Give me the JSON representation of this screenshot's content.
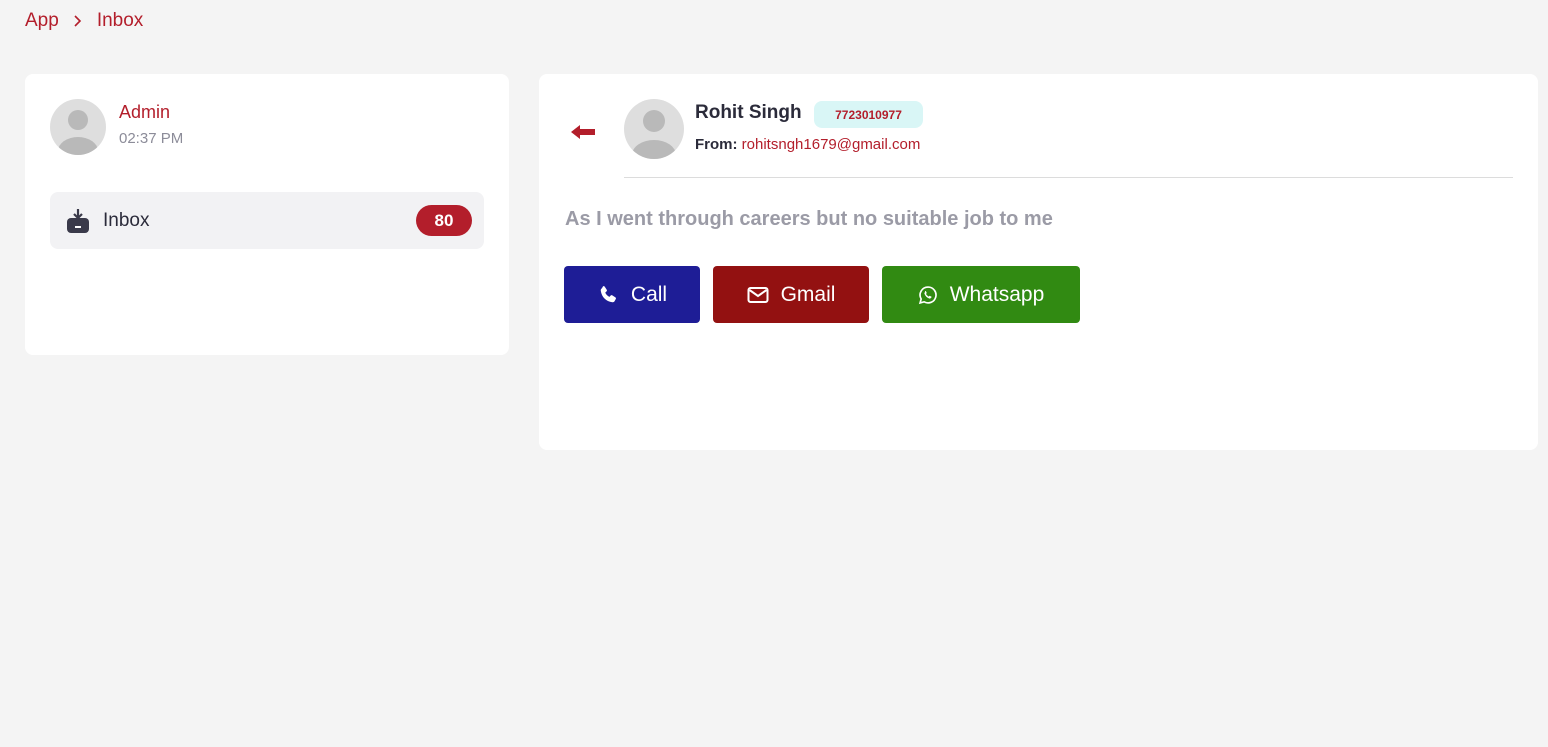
{
  "breadcrumb": {
    "items": [
      "App",
      "Inbox"
    ]
  },
  "sidebar": {
    "user": {
      "name": "Admin",
      "time": "02:37 PM"
    },
    "inbox": {
      "label": "Inbox",
      "count": "80"
    }
  },
  "message_view": {
    "sender_name": "Rohit Singh",
    "phone": "7723010977",
    "from_label": "From:",
    "from_email": "rohitsngh1679@gmail.com",
    "body": "As I went through careers but no suitable job to me",
    "actions": {
      "call": "Call",
      "gmail": "Gmail",
      "whatsapp": "Whatsapp"
    }
  },
  "colors": {
    "accent": "#b31e2b",
    "call": "#1e1d96",
    "gmail": "#931111",
    "whatsapp": "#318a12",
    "phone_badge_bg": "#d9f6f6"
  },
  "icons": [
    "chevron-right-icon",
    "inbox-tray-icon",
    "back-arrow-icon",
    "phone-icon",
    "envelope-icon",
    "whatsapp-icon",
    "avatar-icon"
  ]
}
